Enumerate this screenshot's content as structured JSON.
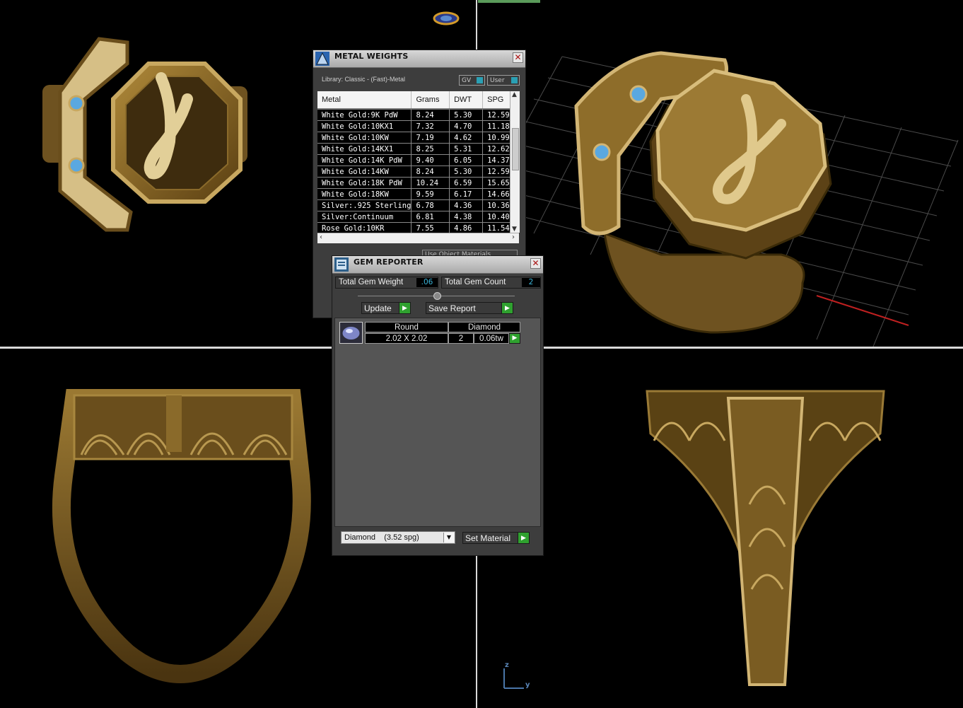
{
  "metal_weights": {
    "title": "METAL WEIGHTS",
    "library_label": "Library: Classic - (Fast)-Metal",
    "gv_label": "GV",
    "user_label": "User",
    "use_object_materials": "Use Object Materials",
    "columns": [
      "Metal",
      "Grams",
      "DWT",
      "SPG"
    ],
    "rows": [
      {
        "metal": "White Gold:9K PdW",
        "grams": "8.24",
        "dwt": "5.30",
        "spg": "12.59"
      },
      {
        "metal": "White Gold:10KX1",
        "grams": "7.32",
        "dwt": "4.70",
        "spg": "11.18"
      },
      {
        "metal": "White Gold:10KW",
        "grams": "7.19",
        "dwt": "4.62",
        "spg": "10.99"
      },
      {
        "metal": "White Gold:14KX1",
        "grams": "8.25",
        "dwt": "5.31",
        "spg": "12.62"
      },
      {
        "metal": "White Gold:14K PdW",
        "grams": "9.40",
        "dwt": "6.05",
        "spg": "14.37"
      },
      {
        "metal": "White Gold:14KW",
        "grams": "8.24",
        "dwt": "5.30",
        "spg": "12.59"
      },
      {
        "metal": "White Gold:18K PdW",
        "grams": "10.24",
        "dwt": "6.59",
        "spg": "15.65"
      },
      {
        "metal": "White Gold:18KW",
        "grams": "9.59",
        "dwt": "6.17",
        "spg": "14.66"
      },
      {
        "metal": "Silver:.925 Sterling",
        "grams": "6.78",
        "dwt": "4.36",
        "spg": "10.36"
      },
      {
        "metal": "Silver:Continuum",
        "grams": "6.81",
        "dwt": "4.38",
        "spg": "10.40"
      },
      {
        "metal": "Rose Gold:10KR",
        "grams": "7.55",
        "dwt": "4.86",
        "spg": "11.54"
      }
    ]
  },
  "gem_reporter": {
    "title": "GEM REPORTER",
    "total_weight_label": "Total Gem Weight",
    "total_weight_value": ".06",
    "total_count_label": "Total Gem Count",
    "total_count_value": "2",
    "update_label": "Update",
    "save_report_label": "Save Report",
    "gem": {
      "shape": "Round",
      "type": "Diamond",
      "size": "2.02 X 2.02",
      "count": "2",
      "ctw": "0.06tw"
    },
    "material_select": "Diamond    (3.52 spg)",
    "set_material_label": "Set Material"
  },
  "axis_triad": {
    "z": "z",
    "y": "y"
  },
  "colors": {
    "viewport_bg": "#000000",
    "gold": "#8a6a2a",
    "gold_light": "#d8c28a",
    "gem_blue": "#5aa8e0",
    "panel_bg": "#3d3d3d",
    "go_green": "#2fa12f",
    "value_cyan": "#3ab4d8"
  },
  "icons": [
    "metal-weights-icon",
    "gem-reporter-icon",
    "close-icon",
    "dropdown-arrow-icon",
    "play-arrow-icon"
  ]
}
